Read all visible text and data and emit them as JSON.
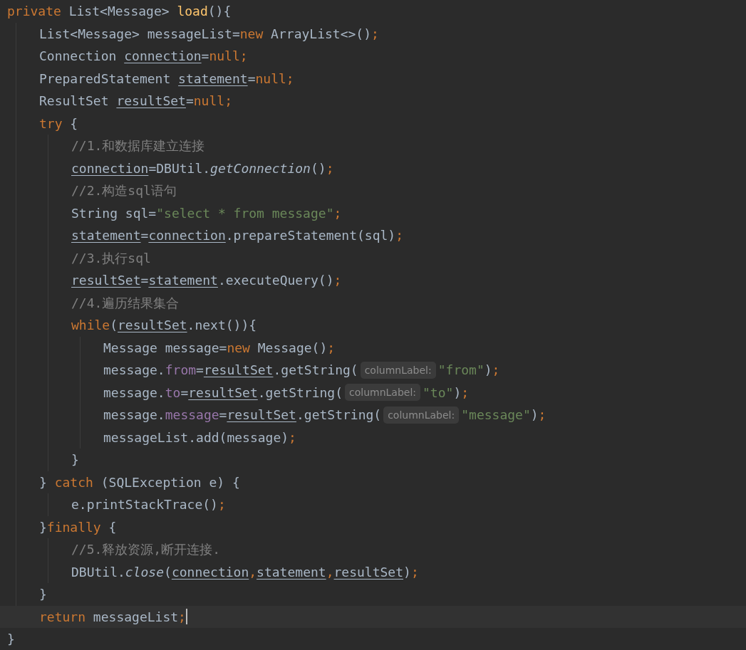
{
  "editor": {
    "lines": [
      {
        "current": false,
        "tokens": [
          {
            "kind": "keyword",
            "text": "private"
          },
          {
            "kind": "plain",
            "text": " List<Message> "
          },
          {
            "kind": "method",
            "text": "load"
          },
          {
            "kind": "plain",
            "text": "(){"
          }
        ],
        "children": [
          {
            "current": false,
            "tokens": [
              {
                "kind": "plain",
                "text": "List<Message> messageList="
              },
              {
                "kind": "keyword",
                "text": "new"
              },
              {
                "kind": "plain",
                "text": " ArrayList<>()"
              },
              {
                "kind": "punct",
                "text": ";"
              }
            ]
          },
          {
            "current": false,
            "tokens": [
              {
                "kind": "plain",
                "text": "Connection "
              },
              {
                "kind": "variable",
                "text": "connection"
              },
              {
                "kind": "plain",
                "text": "="
              },
              {
                "kind": "keyword",
                "text": "null"
              },
              {
                "kind": "punct",
                "text": ";"
              }
            ]
          },
          {
            "current": false,
            "tokens": [
              {
                "kind": "plain",
                "text": "PreparedStatement "
              },
              {
                "kind": "variable",
                "text": "statement"
              },
              {
                "kind": "plain",
                "text": "="
              },
              {
                "kind": "keyword",
                "text": "null"
              },
              {
                "kind": "punct",
                "text": ";"
              }
            ]
          },
          {
            "current": false,
            "tokens": [
              {
                "kind": "plain",
                "text": "ResultSet "
              },
              {
                "kind": "variable",
                "text": "resultSet"
              },
              {
                "kind": "plain",
                "text": "="
              },
              {
                "kind": "keyword",
                "text": "null"
              },
              {
                "kind": "punct",
                "text": ";"
              }
            ]
          },
          {
            "current": false,
            "tokens": [
              {
                "kind": "keyword",
                "text": "try"
              },
              {
                "kind": "plain",
                "text": " {"
              }
            ],
            "children": [
              {
                "current": false,
                "tokens": [
                  {
                    "kind": "comment",
                    "text": "//1.和数据库建立连接"
                  }
                ]
              },
              {
                "current": false,
                "tokens": [
                  {
                    "kind": "variable",
                    "text": "connection"
                  },
                  {
                    "kind": "plain",
                    "text": "=DBUtil."
                  },
                  {
                    "kind": "static",
                    "text": "getConnection"
                  },
                  {
                    "kind": "plain",
                    "text": "()"
                  },
                  {
                    "kind": "punct",
                    "text": ";"
                  }
                ]
              },
              {
                "current": false,
                "tokens": [
                  {
                    "kind": "comment",
                    "text": "//2.构造sql语句"
                  }
                ]
              },
              {
                "current": false,
                "tokens": [
                  {
                    "kind": "plain",
                    "text": "String sql="
                  },
                  {
                    "kind": "string",
                    "text": "\"select * from message\""
                  },
                  {
                    "kind": "punct",
                    "text": ";"
                  }
                ]
              },
              {
                "current": false,
                "tokens": [
                  {
                    "kind": "variable",
                    "text": "statement"
                  },
                  {
                    "kind": "plain",
                    "text": "="
                  },
                  {
                    "kind": "variable",
                    "text": "connection"
                  },
                  {
                    "kind": "plain",
                    "text": ".prepareStatement(sql)"
                  },
                  {
                    "kind": "punct",
                    "text": ";"
                  }
                ]
              },
              {
                "current": false,
                "tokens": [
                  {
                    "kind": "comment",
                    "text": "//3.执行sql"
                  }
                ]
              },
              {
                "current": false,
                "tokens": [
                  {
                    "kind": "variable",
                    "text": "resultSet"
                  },
                  {
                    "kind": "plain",
                    "text": "="
                  },
                  {
                    "kind": "variable",
                    "text": "statement"
                  },
                  {
                    "kind": "plain",
                    "text": ".executeQuery()"
                  },
                  {
                    "kind": "punct",
                    "text": ";"
                  }
                ]
              },
              {
                "current": false,
                "tokens": [
                  {
                    "kind": "comment",
                    "text": "//4.遍历结果集合"
                  }
                ]
              },
              {
                "current": false,
                "tokens": [
                  {
                    "kind": "keyword",
                    "text": "while"
                  },
                  {
                    "kind": "plain",
                    "text": "("
                  },
                  {
                    "kind": "variable",
                    "text": "resultSet"
                  },
                  {
                    "kind": "plain",
                    "text": ".next()){"
                  }
                ],
                "children": [
                  {
                    "current": false,
                    "tokens": [
                      {
                        "kind": "plain",
                        "text": "Message message="
                      },
                      {
                        "kind": "keyword",
                        "text": "new"
                      },
                      {
                        "kind": "plain",
                        "text": " Message()"
                      },
                      {
                        "kind": "punct",
                        "text": ";"
                      }
                    ]
                  },
                  {
                    "current": false,
                    "tokens": [
                      {
                        "kind": "plain",
                        "text": "message."
                      },
                      {
                        "kind": "field",
                        "text": "from"
                      },
                      {
                        "kind": "plain",
                        "text": "="
                      },
                      {
                        "kind": "variable",
                        "text": "resultSet"
                      },
                      {
                        "kind": "plain",
                        "text": ".getString("
                      },
                      {
                        "kind": "hint",
                        "text": "columnLabel:"
                      },
                      {
                        "kind": "string",
                        "text": "\"from\""
                      },
                      {
                        "kind": "plain",
                        "text": ")"
                      },
                      {
                        "kind": "punct",
                        "text": ";"
                      }
                    ]
                  },
                  {
                    "current": false,
                    "tokens": [
                      {
                        "kind": "plain",
                        "text": "message."
                      },
                      {
                        "kind": "field",
                        "text": "to"
                      },
                      {
                        "kind": "plain",
                        "text": "="
                      },
                      {
                        "kind": "variable",
                        "text": "resultSet"
                      },
                      {
                        "kind": "plain",
                        "text": ".getString("
                      },
                      {
                        "kind": "hint",
                        "text": "columnLabel:"
                      },
                      {
                        "kind": "string",
                        "text": "\"to\""
                      },
                      {
                        "kind": "plain",
                        "text": ")"
                      },
                      {
                        "kind": "punct",
                        "text": ";"
                      }
                    ]
                  },
                  {
                    "current": false,
                    "tokens": [
                      {
                        "kind": "plain",
                        "text": "message."
                      },
                      {
                        "kind": "field",
                        "text": "message"
                      },
                      {
                        "kind": "plain",
                        "text": "="
                      },
                      {
                        "kind": "variable",
                        "text": "resultSet"
                      },
                      {
                        "kind": "plain",
                        "text": ".getString("
                      },
                      {
                        "kind": "hint",
                        "text": "columnLabel:"
                      },
                      {
                        "kind": "string",
                        "text": "\"message\""
                      },
                      {
                        "kind": "plain",
                        "text": ")"
                      },
                      {
                        "kind": "punct",
                        "text": ";"
                      }
                    ]
                  },
                  {
                    "current": false,
                    "tokens": [
                      {
                        "kind": "plain",
                        "text": "messageList.add(message)"
                      },
                      {
                        "kind": "punct",
                        "text": ";"
                      }
                    ]
                  }
                ]
              },
              {
                "current": false,
                "tokens": [
                  {
                    "kind": "plain",
                    "text": "}"
                  }
                ]
              }
            ]
          },
          {
            "current": false,
            "tokens": [
              {
                "kind": "plain",
                "text": "} "
              },
              {
                "kind": "keyword",
                "text": "catch"
              },
              {
                "kind": "plain",
                "text": " (SQLException e) {"
              }
            ],
            "children": [
              {
                "current": false,
                "tokens": [
                  {
                    "kind": "plain",
                    "text": "e.printStackTrace()"
                  },
                  {
                    "kind": "punct",
                    "text": ";"
                  }
                ]
              }
            ]
          },
          {
            "current": false,
            "tokens": [
              {
                "kind": "plain",
                "text": "}"
              },
              {
                "kind": "keyword",
                "text": "finally"
              },
              {
                "kind": "plain",
                "text": " {"
              }
            ],
            "children": [
              {
                "current": false,
                "tokens": [
                  {
                    "kind": "comment",
                    "text": "//5.释放资源,断开连接."
                  }
                ]
              },
              {
                "current": false,
                "tokens": [
                  {
                    "kind": "plain",
                    "text": "DBUtil."
                  },
                  {
                    "kind": "static",
                    "text": "close"
                  },
                  {
                    "kind": "plain",
                    "text": "("
                  },
                  {
                    "kind": "variable",
                    "text": "connection"
                  },
                  {
                    "kind": "punct",
                    "text": ","
                  },
                  {
                    "kind": "variable",
                    "text": "statement"
                  },
                  {
                    "kind": "punct",
                    "text": ","
                  },
                  {
                    "kind": "variable",
                    "text": "resultSet"
                  },
                  {
                    "kind": "plain",
                    "text": ")"
                  },
                  {
                    "kind": "punct",
                    "text": ";"
                  }
                ]
              }
            ]
          },
          {
            "current": false,
            "tokens": [
              {
                "kind": "plain",
                "text": "}"
              }
            ]
          },
          {
            "current": true,
            "tokens": [
              {
                "kind": "keyword",
                "text": "return"
              },
              {
                "kind": "plain",
                "text": " messageList"
              },
              {
                "kind": "punct",
                "text": ";"
              }
            ]
          }
        ]
      },
      {
        "current": false,
        "tokens": [
          {
            "kind": "plain",
            "text": "}"
          }
        ]
      }
    ]
  }
}
